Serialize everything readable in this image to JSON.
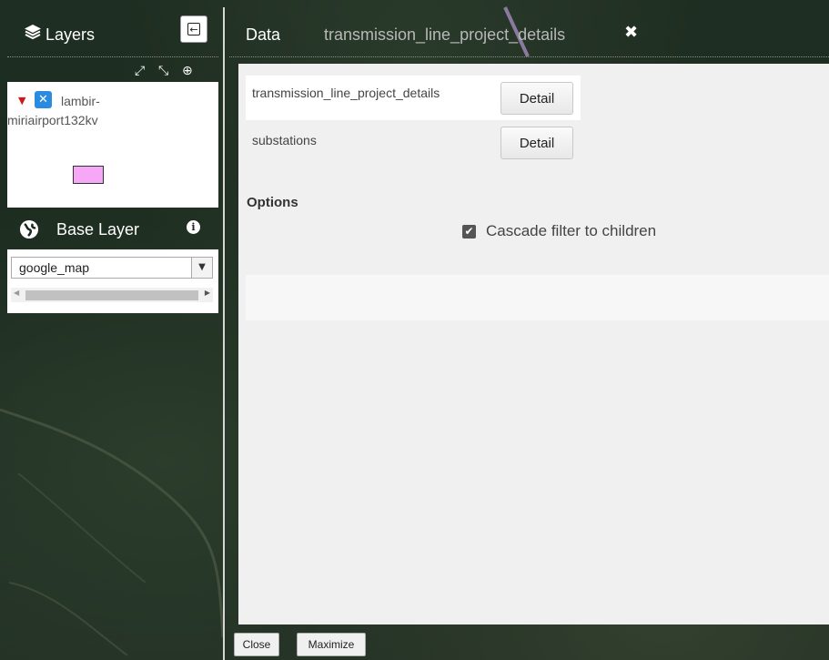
{
  "layers": {
    "title": "Layers",
    "icon": "layers-stack-icon",
    "collapse_icon": "arrow-left-box-icon",
    "tools": [
      "expand-icon",
      "collapse-icon",
      "zoom-icon"
    ],
    "items": [
      {
        "name_line1": "lambir-",
        "name_line2": "miriairport132kv",
        "checked": true,
        "legend_color": "#f6a8f6"
      }
    ]
  },
  "base_layer": {
    "title": "Base Layer",
    "icon": "globe-icon",
    "info_icon": "info-icon",
    "selected": "google_map"
  },
  "data_panel": {
    "tab_label": "Data",
    "subtab_label": "transmission_line_project_details",
    "close_icon": "close-icon",
    "rows": [
      {
        "label": "transmission_line_project_details",
        "button": "Detail"
      },
      {
        "label": "substations",
        "button": "Detail"
      }
    ],
    "options_label": "Options",
    "cascade_label": "Cascade filter to children",
    "cascade_checked": true
  },
  "footer": {
    "close_label": "Close",
    "maximize_label": "Maximize"
  }
}
